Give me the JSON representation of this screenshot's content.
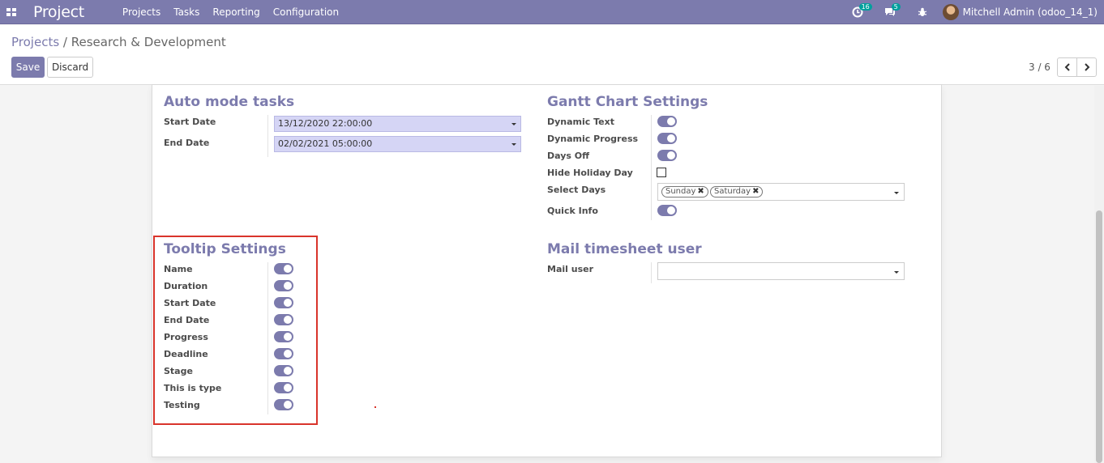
{
  "navbar": {
    "brand": "Project",
    "menu": [
      "Projects",
      "Tasks",
      "Reporting",
      "Configuration"
    ],
    "activity_count": "16",
    "messages_count": "5",
    "user": "Mitchell Admin (odoo_14_1)"
  },
  "control_panel": {
    "breadcrumb_parent": "Projects",
    "breadcrumb_separator": " / ",
    "breadcrumb_current": "Research & Development",
    "save_label": "Save",
    "discard_label": "Discard",
    "pager_value": "3 / 6"
  },
  "auto_mode": {
    "title": "Auto mode tasks",
    "start_date_label": "Start Date",
    "start_date_value": "13/12/2020 22:00:00",
    "end_date_label": "End Date",
    "end_date_value": "02/02/2021 05:00:00"
  },
  "gantt": {
    "title": "Gantt Chart Settings",
    "dynamic_text_label": "Dynamic Text",
    "dynamic_progress_label": "Dynamic Progress",
    "days_off_label": "Days Off",
    "hide_holiday_label": "Hide Holiday Day",
    "select_days_label": "Select Days",
    "select_days_tags": [
      "Sunday",
      "Saturday"
    ],
    "quick_info_label": "Quick Info"
  },
  "tooltip": {
    "title": "Tooltip Settings",
    "fields": [
      "Name",
      "Duration",
      "Start Date",
      "End Date",
      "Progress",
      "Deadline",
      "Stage",
      "This is type",
      "Testing"
    ]
  },
  "mail": {
    "title": "Mail timesheet user",
    "mail_user_label": "Mail user",
    "mail_user_value": ""
  },
  "colors": {
    "primary": "#7c7bad",
    "highlight": "#d9342b",
    "date_field_bg": "#d5d5f5",
    "badge": "#00a09d"
  }
}
